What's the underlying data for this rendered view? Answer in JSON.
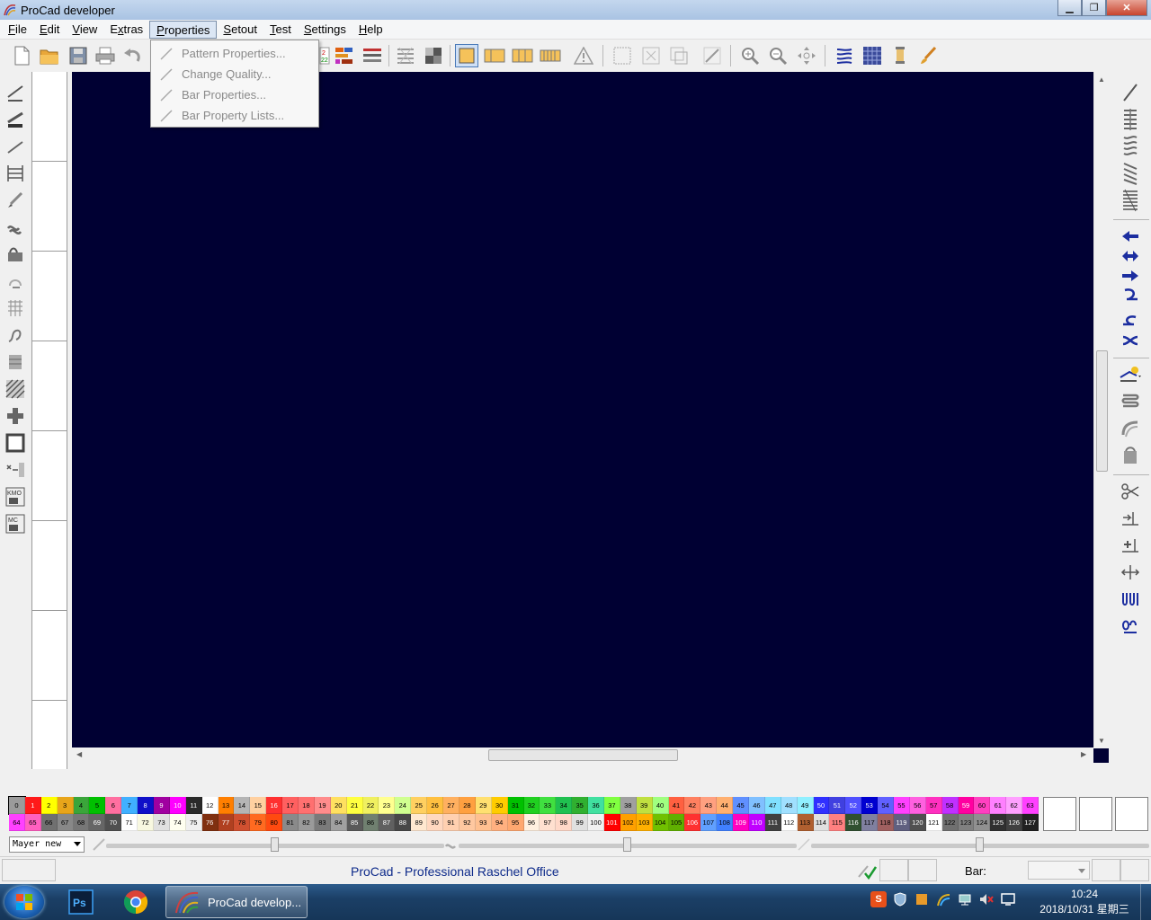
{
  "window": {
    "title": "ProCad developer",
    "controls": [
      "minimize",
      "maximize",
      "close"
    ]
  },
  "menubar": {
    "items": [
      {
        "label": "File",
        "key": "F"
      },
      {
        "label": "Edit",
        "key": "E"
      },
      {
        "label": "View",
        "key": "V"
      },
      {
        "label": "Extras",
        "key": "x"
      },
      {
        "label": "Properties",
        "key": "P",
        "active": true
      },
      {
        "label": "Setout",
        "key": "S"
      },
      {
        "label": "Test",
        "key": "T"
      },
      {
        "label": "Settings",
        "key": "S"
      },
      {
        "label": "Help",
        "key": "H"
      }
    ]
  },
  "properties_menu": {
    "items": [
      {
        "label": "Pattern Properties...",
        "enabled": false
      },
      {
        "label": "Change Quality...",
        "enabled": false
      },
      {
        "label": "Bar Properties...",
        "enabled": false
      },
      {
        "label": "Bar Property Lists...",
        "enabled": false
      }
    ]
  },
  "toolbar": {
    "icons": [
      "new-file-icon",
      "open-folder-icon",
      "save-icon",
      "print-icon",
      "undo-icon",
      "numbered-list-icon",
      "bar-colors-icon",
      "bar-lines-icon",
      "pattern-grid-icon",
      "block-fill-icon",
      "frame-single-icon",
      "frame-double-icon",
      "frame-triple-icon",
      "frame-multi-icon",
      "warning-icon",
      "select-rect-icon",
      "select-free-icon",
      "select-copy-icon",
      "select-line-icon",
      "zoom-in-icon",
      "zoom-out-icon",
      "pan-icon",
      "stitch-view-icon",
      "fabric-view-icon",
      "yarn-bobbin-icon",
      "brush-tool-icon"
    ]
  },
  "colors": {
    "canvas": "#000033",
    "status_text": "#0d2a8a",
    "accent_blue": "#1c2ea0"
  },
  "palette": {
    "row1": [
      "0",
      "1",
      "2",
      "3",
      "4",
      "5",
      "6",
      "7",
      "8",
      "9",
      "10",
      "11",
      "12",
      "13",
      "14",
      "15",
      "16",
      "17",
      "18",
      "19",
      "20",
      "21",
      "22",
      "23",
      "24",
      "25",
      "26",
      "27",
      "28",
      "29",
      "30",
      "31",
      "32",
      "33",
      "34",
      "35",
      "36",
      "37",
      "38",
      "39",
      "40",
      "41",
      "42",
      "43",
      "44",
      "45",
      "46",
      "47",
      "48",
      "49",
      "50",
      "51",
      "52",
      "53",
      "54",
      "55",
      "56",
      "57",
      "58",
      "59",
      "60",
      "61",
      "62",
      "63"
    ],
    "row1_colors": [
      "#9b9b9b",
      "#ff1a1a",
      "#ffff00",
      "#e8a51a",
      "#3aa53a",
      "#00c000",
      "#ff6fa0",
      "#40b0ff",
      "#1010c8",
      "#a000a0",
      "#ff00ff",
      "#2a2a2a",
      "#ffffff",
      "#ff7f00",
      "#b5b5b5",
      "#ffd0a0",
      "#ff3030",
      "#ff6060",
      "#ff7070",
      "#ff8c8c",
      "#ffe060",
      "#ffff40",
      "#f0f060",
      "#ffff90",
      "#d0ff90",
      "#ffd060",
      "#ffc040",
      "#ffb060",
      "#ffa040",
      "#ffe070",
      "#ffcc00",
      "#00c000",
      "#20d020",
      "#40e040",
      "#20c050",
      "#30b030",
      "#40e0a0",
      "#80ff40",
      "#a0a0a0",
      "#c0e040",
      "#a0ff80",
      "#ff6040",
      "#ff8060",
      "#ffa080",
      "#ffb070",
      "#6090ff",
      "#80c0ff",
      "#80e0ff",
      "#a0e0ff",
      "#90f0ff",
      "#3030ff",
      "#4040e0",
      "#5050ff",
      "#0000d0",
      "#6060ff",
      "#ff40ff",
      "#ff60e0",
      "#ff30c0",
      "#c030ff",
      "#ff00a0",
      "#ff40c0",
      "#ff80ff",
      "#ffa0ff",
      "#ff40ff"
    ],
    "row2": [
      "64",
      "65",
      "66",
      "67",
      "68",
      "69",
      "70",
      "71",
      "72",
      "73",
      "74",
      "75",
      "76",
      "77",
      "78",
      "79",
      "80",
      "81",
      "82",
      "83",
      "84",
      "85",
      "86",
      "87",
      "88",
      "89",
      "90",
      "91",
      "92",
      "93",
      "94",
      "95",
      "96",
      "97",
      "98",
      "99",
      "100",
      "101",
      "102",
      "103",
      "104",
      "105",
      "106",
      "107",
      "108",
      "109",
      "110",
      "111",
      "112",
      "113",
      "114",
      "115",
      "116",
      "117",
      "118",
      "119",
      "120",
      "121",
      "122",
      "123",
      "124",
      "125",
      "126",
      "127"
    ],
    "row2_colors": [
      "#ff40ff",
      "#ff60c0",
      "#707070",
      "#888888",
      "#777777",
      "#666666",
      "#505050",
      "#ffffff",
      "#f8f8e0",
      "#e0e0e0",
      "#fffff0",
      "#f0f0f0",
      "#803010",
      "#b04020",
      "#d05030",
      "#ff6a20",
      "#ff4a10",
      "#8a8a8a",
      "#9a9a9a",
      "#7a7a7a",
      "#a0a0a0",
      "#5a5a5a",
      "#708070",
      "#606060",
      "#484848",
      "#ffe8d0",
      "#ffd8c0",
      "#ffd0b0",
      "#ffc8a0",
      "#ffc090",
      "#ffb080",
      "#ffa870",
      "#fff0e0",
      "#ffe0d0",
      "#ffd8c8",
      "#e0e0e0",
      "#f0f0f0",
      "#ff0000",
      "#ffa000",
      "#ffb000",
      "#70c000",
      "#60b000",
      "#ff3030",
      "#60a0ff",
      "#4080ff",
      "#ff00c0",
      "#c000ff",
      "#404040",
      "#ffffff",
      "#b06030",
      "#e0e0e0",
      "#ff8080",
      "#305030",
      "#8080a0",
      "#a06060",
      "#606080",
      "#505050",
      "#ffffff",
      "#707070",
      "#808080",
      "#909090",
      "#303030",
      "#404040",
      "#202020"
    ]
  },
  "layer": {
    "selected": "Mayer new"
  },
  "status": {
    "app_name": "ProCad - Professional Raschel Office",
    "bar_label": "Bar:",
    "bar_value": ""
  },
  "taskbar": {
    "apps": [
      {
        "name": "photoshop",
        "label": ""
      },
      {
        "name": "chrome",
        "label": ""
      },
      {
        "name": "procad",
        "label": "ProCad develop..."
      }
    ],
    "time": "10:24",
    "date": "2018/10/31 星期三"
  }
}
